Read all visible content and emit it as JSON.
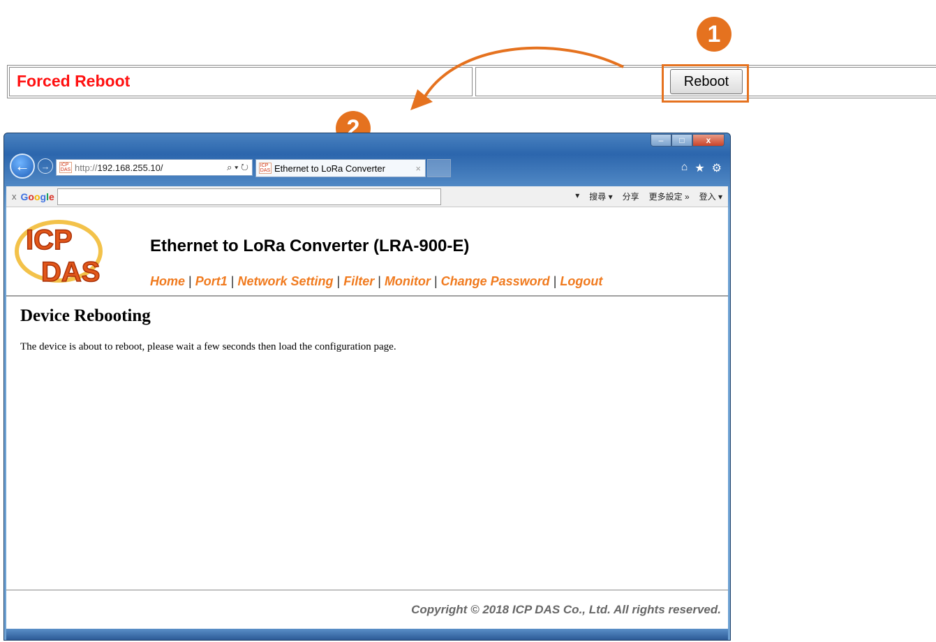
{
  "config_row": {
    "label": "Forced Reboot",
    "button_label": "Reboot"
  },
  "steps": {
    "step1": "1",
    "step2": "2"
  },
  "colors": {
    "accent": "#e5721f",
    "danger": "#ff1010",
    "nav_link": "#f07a1e"
  },
  "browser": {
    "address_url_scheme": "http://",
    "address_url_host": "192.168.255.10/",
    "address_tools": "⌕ ▾ ↻",
    "tab_title": "Ethernet to LoRa Converter",
    "tab_close": "×",
    "favicon_text": "ICP DAS",
    "window_buttons": {
      "minimize": "–",
      "maximize": "□",
      "close": "x"
    },
    "right_icons": [
      "⌂",
      "★",
      "⚙"
    ],
    "google_bar": {
      "close": "x",
      "logo": "Google",
      "tools": [
        "▾",
        "搜尋 ▾",
        "分享",
        "更多設定 »",
        "登入 ▾"
      ]
    }
  },
  "page": {
    "title": "Ethernet to LoRa Converter (LRA-900-E)",
    "nav": [
      "Home",
      "Port1",
      "Network Setting",
      "Filter",
      "Monitor",
      "Change Password",
      "Logout"
    ],
    "nav_separator": "|",
    "heading": "Device Rebooting",
    "message": "The device is about to reboot, please wait a few seconds then load the configuration page.",
    "footer": "Copyright © 2018 ICP DAS Co., Ltd. All rights reserved.",
    "logo_text": "ICP DAS"
  }
}
